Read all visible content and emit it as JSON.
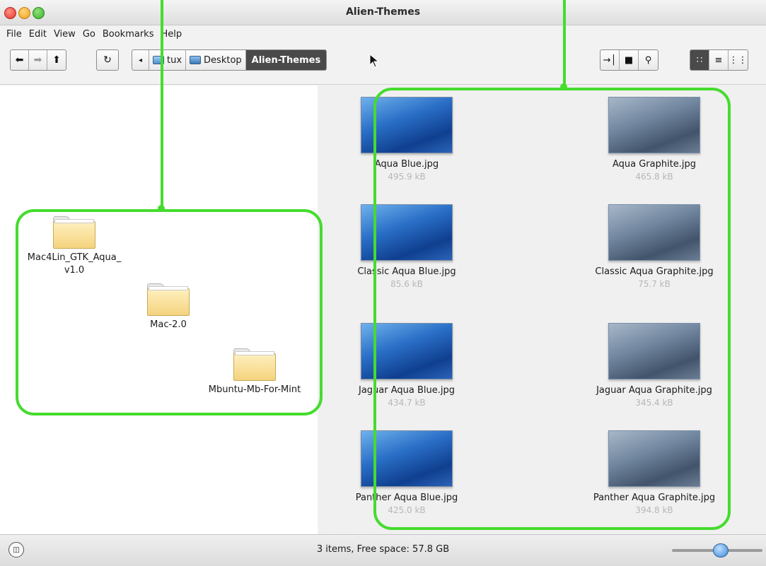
{
  "window": {
    "title": "Alien-Themes"
  },
  "menubar": {
    "items": [
      "File",
      "Edit",
      "View",
      "Go",
      "Bookmarks",
      "Help"
    ]
  },
  "toolbar": {
    "nav_buttons": [
      {
        "icon": "back-arrow-icon",
        "glyph": "⬅"
      },
      {
        "icon": "forward-arrow-icon",
        "glyph": "➡"
      },
      {
        "icon": "up-arrow-icon",
        "glyph": "⬆"
      }
    ],
    "reload_glyph": "↻",
    "breadcrumb": {
      "back_glyph": "◂",
      "items": [
        {
          "label": "tux",
          "icon": "home-folder-icon"
        },
        {
          "label": "Desktop",
          "icon": "desktop-icon"
        },
        {
          "label": "Alien-Themes",
          "active": true
        }
      ]
    },
    "tools_glyphs": {
      "open_terminal": "→│",
      "folder": "■",
      "search": "⚲"
    },
    "view_glyphs": {
      "icon_view": "∷",
      "list_view": "≡",
      "compact_view": "⋮⋮"
    }
  },
  "left_pane": {
    "folders": [
      {
        "name": "Mac4Lin_GTK_Aqua_ v1.0"
      },
      {
        "name": "Mac-2.0"
      },
      {
        "name": "Mbuntu-Mb-For-Mint"
      }
    ]
  },
  "right_pane": {
    "files": [
      {
        "name": "Aqua Blue.jpg",
        "size": "495.9 kB",
        "tint": "blue"
      },
      {
        "name": "Aqua Graphite.jpg",
        "size": "465.8 kB",
        "tint": "graphite"
      },
      {
        "name": "Classic Aqua Blue.jpg",
        "size": "85.6 kB",
        "tint": "blue"
      },
      {
        "name": "Classic Aqua Graphite.jpg",
        "size": "75.7 kB",
        "tint": "graphite"
      },
      {
        "name": "Jaguar Aqua Blue.jpg",
        "size": "434.7 kB",
        "tint": "blue"
      },
      {
        "name": "Jaguar Aqua Graphite.jpg",
        "size": "345.4 kB",
        "tint": "graphite"
      },
      {
        "name": "Panther Aqua Blue.jpg",
        "size": "425.0 kB",
        "tint": "blue"
      },
      {
        "name": "Panther Aqua Graphite.jpg",
        "size": "394.8 kB",
        "tint": "graphite"
      }
    ]
  },
  "statusbar": {
    "text": "3 items, Free space: 57.8 GB",
    "zoom_level": 0.55
  },
  "colors": {
    "annotation": "#45dc2e",
    "active_crumb": "#4a4a4a",
    "size_text": "#b7b7b7"
  }
}
